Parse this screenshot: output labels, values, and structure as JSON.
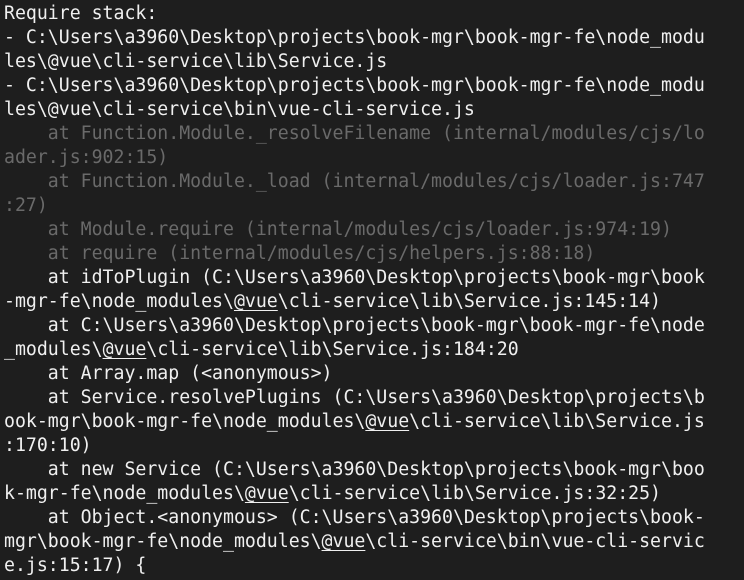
{
  "terminal": {
    "lines": [
      {
        "style": "bright",
        "segments": [
          {
            "t": "Require stack:"
          }
        ]
      },
      {
        "style": "bright",
        "segments": [
          {
            "t": "- C:\\Users\\a3960\\Desktop\\projects\\book-mgr\\book-mgr-fe\\node_modu"
          }
        ]
      },
      {
        "style": "bright",
        "segments": [
          {
            "t": "les\\@vue\\cli-service\\lib\\Service.js"
          }
        ]
      },
      {
        "style": "bright",
        "segments": [
          {
            "t": "- C:\\Users\\a3960\\Desktop\\projects\\book-mgr\\book-mgr-fe\\node_modu"
          }
        ]
      },
      {
        "style": "bright",
        "segments": [
          {
            "t": "les\\@vue\\cli-service\\bin\\vue-cli-service.js"
          }
        ]
      },
      {
        "style": "dim",
        "segments": [
          {
            "t": "    at Function.Module._resolveFilename (internal/modules/cjs/lo"
          }
        ]
      },
      {
        "style": "dim",
        "segments": [
          {
            "t": "ader.js:902:15)"
          }
        ]
      },
      {
        "style": "dim",
        "segments": [
          {
            "t": "    at Function.Module._load (internal/modules/cjs/loader.js:747"
          }
        ]
      },
      {
        "style": "dim",
        "segments": [
          {
            "t": ":27)"
          }
        ]
      },
      {
        "style": "dim",
        "segments": [
          {
            "t": "    at Module.require (internal/modules/cjs/loader.js:974:19)"
          }
        ]
      },
      {
        "style": "dim",
        "segments": [
          {
            "t": "    at require (internal/modules/cjs/helpers.js:88:18)"
          }
        ]
      },
      {
        "style": "bright",
        "segments": [
          {
            "t": "    at idToPlugin (C:\\Users\\a3960\\Desktop\\projects\\book-mgr\\book"
          }
        ]
      },
      {
        "style": "bright",
        "segments": [
          {
            "t": "-mgr-fe\\node_modules\\"
          },
          {
            "t": "@vue",
            "u": true
          },
          {
            "t": "\\cli-service\\lib\\Service.js:145:14)"
          }
        ]
      },
      {
        "style": "bright",
        "segments": [
          {
            "t": "    at C:\\Users\\a3960\\Desktop\\projects\\book-mgr\\book-mgr-fe\\node"
          }
        ]
      },
      {
        "style": "bright",
        "segments": [
          {
            "t": "_modules\\"
          },
          {
            "t": "@vue",
            "u": true
          },
          {
            "t": "\\cli-service\\lib\\Service.js:184:20"
          }
        ]
      },
      {
        "style": "bright",
        "segments": [
          {
            "t": "    at Array.map (<anonymous>)"
          }
        ]
      },
      {
        "style": "bright",
        "segments": [
          {
            "t": "    at Service.resolvePlugins (C:\\Users\\a3960\\Desktop\\projects\\b"
          }
        ]
      },
      {
        "style": "bright",
        "segments": [
          {
            "t": "ook-mgr\\book-mgr-fe\\node_modules\\"
          },
          {
            "t": "@vue",
            "u": true
          },
          {
            "t": "\\cli-service\\lib\\Service.js"
          }
        ]
      },
      {
        "style": "bright",
        "segments": [
          {
            "t": ":170:10)"
          }
        ]
      },
      {
        "style": "bright",
        "segments": [
          {
            "t": "    at new Service (C:\\Users\\a3960\\Desktop\\projects\\book-mgr\\boo"
          }
        ]
      },
      {
        "style": "bright",
        "segments": [
          {
            "t": "k-mgr-fe\\node_modules\\"
          },
          {
            "t": "@vue",
            "u": true
          },
          {
            "t": "\\cli-service\\lib\\Service.js:32:25)"
          }
        ]
      },
      {
        "style": "bright",
        "segments": [
          {
            "t": "    at Object.<anonymous> (C:\\Users\\a3960\\Desktop\\projects\\book-"
          }
        ]
      },
      {
        "style": "bright",
        "segments": [
          {
            "t": "mgr\\book-mgr-fe\\node_modules\\"
          },
          {
            "t": "@vue",
            "u": true
          },
          {
            "t": "\\cli-service\\bin\\vue-cli-servic"
          }
        ]
      },
      {
        "style": "bright",
        "segments": [
          {
            "t": "e.js:15:17) {"
          }
        ]
      }
    ]
  },
  "colors": {
    "background": "#1e1e1e",
    "text": "#f0f0f0",
    "dim_text": "#6a6a6a"
  }
}
